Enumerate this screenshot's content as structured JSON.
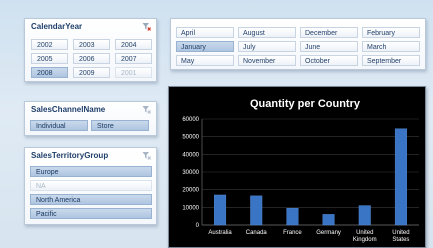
{
  "calendar_year": {
    "title": "CalendarYear",
    "items": [
      {
        "label": "2002",
        "selected": false,
        "has_data": true
      },
      {
        "label": "2003",
        "selected": false,
        "has_data": true
      },
      {
        "label": "2004",
        "selected": false,
        "has_data": true
      },
      {
        "label": "2005",
        "selected": false,
        "has_data": true
      },
      {
        "label": "2006",
        "selected": false,
        "has_data": true
      },
      {
        "label": "2007",
        "selected": false,
        "has_data": true
      },
      {
        "label": "2008",
        "selected": true,
        "has_data": true
      },
      {
        "label": "2009",
        "selected": false,
        "has_data": true
      },
      {
        "label": "2001",
        "selected": false,
        "has_data": false
      }
    ]
  },
  "month": {
    "items": [
      {
        "label": "April",
        "selected": false
      },
      {
        "label": "August",
        "selected": false
      },
      {
        "label": "December",
        "selected": false
      },
      {
        "label": "February",
        "selected": false
      },
      {
        "label": "January",
        "selected": true
      },
      {
        "label": "July",
        "selected": false
      },
      {
        "label": "June",
        "selected": false
      },
      {
        "label": "March",
        "selected": false
      },
      {
        "label": "May",
        "selected": false
      },
      {
        "label": "November",
        "selected": false
      },
      {
        "label": "October",
        "selected": false
      },
      {
        "label": "September",
        "selected": false
      }
    ]
  },
  "sales_channel": {
    "title": "SalesChannelName",
    "items": [
      {
        "label": "Individual",
        "selected": true
      },
      {
        "label": "Store",
        "selected": true
      }
    ]
  },
  "sales_territory": {
    "title": "SalesTerritoryGroup",
    "items": [
      {
        "label": "Europe",
        "selected": true,
        "has_data": true
      },
      {
        "label": "NA",
        "selected": false,
        "has_data": false
      },
      {
        "label": "North America",
        "selected": true,
        "has_data": true
      },
      {
        "label": "Pacific",
        "selected": true,
        "has_data": true
      }
    ]
  },
  "chart_data": {
    "type": "bar",
    "title": "Quantity per Country",
    "categories": [
      "Australia",
      "Canada",
      "France",
      "Germany",
      "United Kingdom",
      "United States"
    ],
    "category_labels": [
      [
        "Australia"
      ],
      [
        "Canada"
      ],
      [
        "France"
      ],
      [
        "Germany"
      ],
      [
        "United",
        "Kingdom"
      ],
      [
        "United",
        "States"
      ]
    ],
    "values": [
      17000,
      16500,
      9500,
      6000,
      11000,
      54500
    ],
    "ylim": [
      0,
      60000
    ],
    "yticks": [
      "0",
      "10000",
      "20000",
      "30000",
      "40000",
      "50000",
      "60000"
    ],
    "grid": true,
    "bar_color": "#3a74c4",
    "background": "#000000",
    "text_color": "#ffffff"
  },
  "colors": {
    "slicer_selected": "#b8cde6",
    "slicer_border": "#b9c9da",
    "header_text": "#1f3f6a"
  }
}
